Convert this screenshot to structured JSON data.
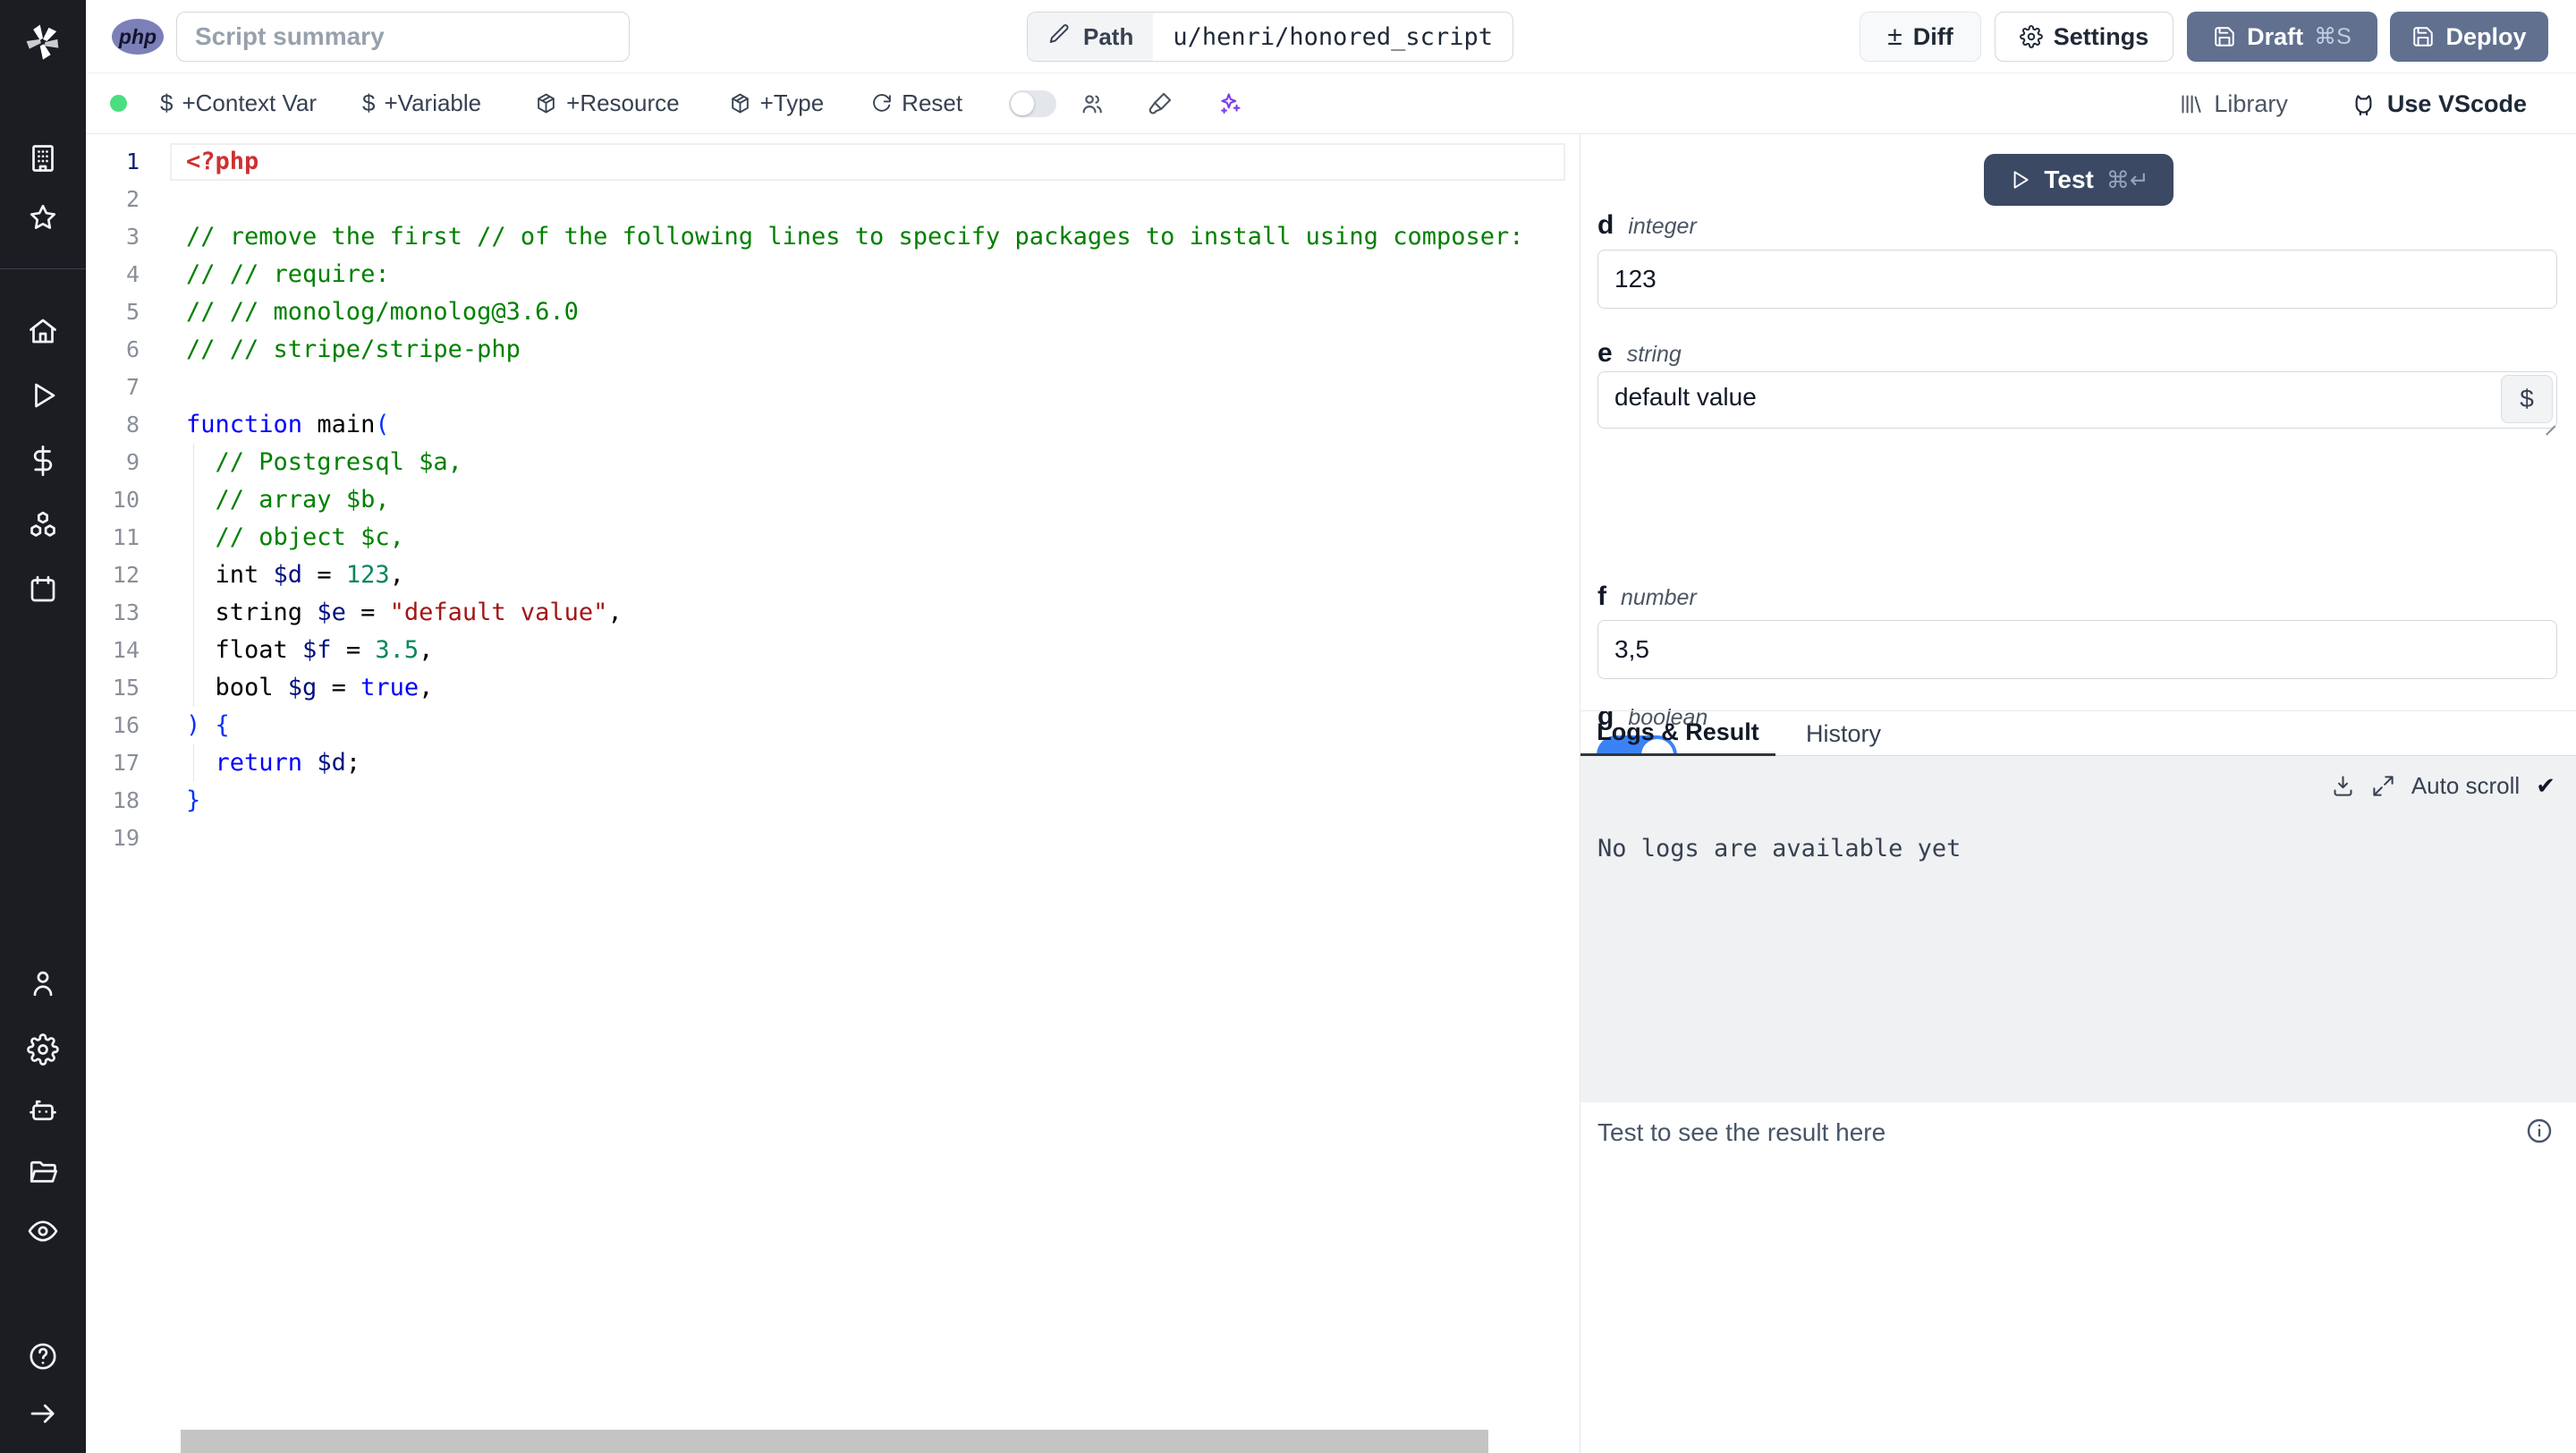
{
  "theme": {
    "sidebar_bg": "#1b1d23",
    "primary_button_bg": "#61708f",
    "test_button_bg": "#3b4964",
    "php_badge_bg": "#7b80b8",
    "status_dot_green": "#4ade80",
    "ai_sparkle_purple": "#7c3aed",
    "toggle_on_blue": "#3b82f6",
    "logs_panel_bg": "#eff1f3"
  },
  "icons": {
    "dollar": "$",
    "plusminus": "±",
    "check": "✔"
  },
  "sidebar": {
    "items": [
      "windmill-logo",
      "workspace",
      "favorites",
      "home",
      "runs",
      "variables",
      "resources",
      "schedules",
      "user",
      "settings",
      "workers",
      "folders",
      "audit",
      "help",
      "expand"
    ]
  },
  "topbar": {
    "language_badge": "php",
    "summary_placeholder": "Script summary",
    "path_label": "Path",
    "path_value": "u/henri/honored_script",
    "diff_label": "Diff",
    "settings_label": "Settings",
    "draft_label": "Draft",
    "draft_shortcut": "⌘S",
    "deploy_label": "Deploy"
  },
  "toolbar": {
    "context_var_label": "+Context Var",
    "variable_label": "+Variable",
    "resource_label": "+Resource",
    "type_label": "+Type",
    "reset_label": "Reset",
    "library_label": "Library",
    "vscode_label": "Use VScode"
  },
  "editor": {
    "language": "php",
    "lines": [
      {
        "current": true,
        "tokens": [
          [
            "meta",
            "<?php"
          ]
        ]
      },
      {
        "tokens": []
      },
      {
        "tokens": [
          [
            "comment",
            "// remove the first // of the following lines to specify packages to install using composer:"
          ]
        ]
      },
      {
        "tokens": [
          [
            "comment",
            "// // require:"
          ]
        ]
      },
      {
        "tokens": [
          [
            "comment",
            "// // monolog/monolog@3.6.0"
          ]
        ]
      },
      {
        "tokens": [
          [
            "comment",
            "// // stripe/stripe-php"
          ]
        ]
      },
      {
        "tokens": []
      },
      {
        "tokens": [
          [
            "kw",
            "function"
          ],
          [
            "plain",
            " "
          ],
          [
            "fn",
            "main"
          ],
          [
            "bracket",
            "("
          ]
        ]
      },
      {
        "guide": true,
        "tokens": [
          [
            "plain",
            "  "
          ],
          [
            "comment",
            "// Postgresql $a,"
          ]
        ]
      },
      {
        "guide": true,
        "tokens": [
          [
            "plain",
            "  "
          ],
          [
            "comment",
            "// array $b,"
          ]
        ]
      },
      {
        "guide": true,
        "tokens": [
          [
            "plain",
            "  "
          ],
          [
            "comment",
            "// object $c,"
          ]
        ]
      },
      {
        "guide": true,
        "tokens": [
          [
            "plain",
            "  int "
          ],
          [
            "var",
            "$d"
          ],
          [
            "plain",
            " = "
          ],
          [
            "num",
            "123"
          ],
          [
            "plain",
            ","
          ]
        ]
      },
      {
        "guide": true,
        "tokens": [
          [
            "plain",
            "  string "
          ],
          [
            "var",
            "$e"
          ],
          [
            "plain",
            " = "
          ],
          [
            "str",
            "\"default value\""
          ],
          [
            "plain",
            ","
          ]
        ]
      },
      {
        "guide": true,
        "tokens": [
          [
            "plain",
            "  float "
          ],
          [
            "var",
            "$f"
          ],
          [
            "plain",
            " = "
          ],
          [
            "num",
            "3.5"
          ],
          [
            "plain",
            ","
          ]
        ]
      },
      {
        "guide": true,
        "tokens": [
          [
            "plain",
            "  bool "
          ],
          [
            "var",
            "$g"
          ],
          [
            "plain",
            " = "
          ],
          [
            "kw",
            "true"
          ],
          [
            "plain",
            ","
          ]
        ]
      },
      {
        "tokens": [
          [
            "bracket",
            ") {"
          ]
        ]
      },
      {
        "guide": true,
        "tokens": [
          [
            "plain",
            "  "
          ],
          [
            "kw",
            "return"
          ],
          [
            "plain",
            " "
          ],
          [
            "var",
            "$d"
          ],
          [
            "plain",
            ";"
          ]
        ]
      },
      {
        "tokens": [
          [
            "bracket",
            "}"
          ]
        ]
      },
      {
        "tokens": []
      }
    ]
  },
  "form": {
    "test_label": "Test",
    "test_shortcut": "⌘↵",
    "fields": [
      {
        "name": "d",
        "type": "integer",
        "value": "123"
      },
      {
        "name": "e",
        "type": "string",
        "value": "default value"
      },
      {
        "name": "f",
        "type": "number",
        "value": "3,5"
      },
      {
        "name": "g",
        "type": "boolean",
        "value": "on"
      }
    ]
  },
  "results": {
    "tabs": [
      {
        "label": "Logs & Result"
      },
      {
        "label": "History"
      }
    ],
    "active_tab": "Logs & Result",
    "auto_scroll_label": "Auto scroll",
    "no_logs_message": "No logs are available yet",
    "result_placeholder": "Test to see the result here"
  }
}
